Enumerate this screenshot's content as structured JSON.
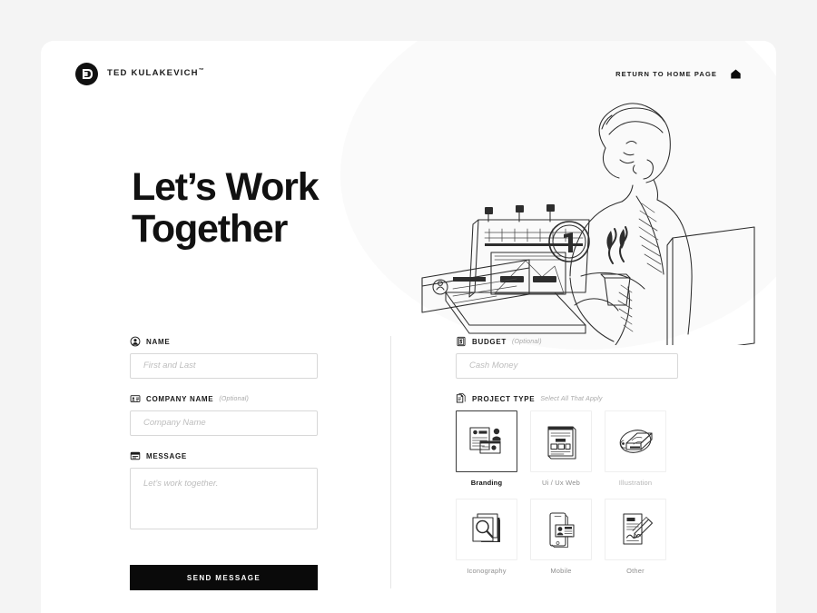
{
  "header": {
    "brand_name": "TED KULAKEVICH",
    "brand_tm": "™",
    "logo_icon": "d-monogram-icon",
    "return_label": "RETURN TO HOME PAGE",
    "home_icon": "home-icon"
  },
  "hero": {
    "title_line1": "Let’s Work",
    "title_line2": "Together",
    "illustration": "sketch-person-with-laptop-and-coffee"
  },
  "form": {
    "name": {
      "icon": "user-avatar-icon",
      "label": "NAME",
      "hint": "",
      "placeholder": "First and Last",
      "value": ""
    },
    "company": {
      "icon": "business-card-icon",
      "label": "COMPANY NAME",
      "hint": "(Optional)",
      "placeholder": "Company Name",
      "value": ""
    },
    "message": {
      "icon": "message-note-icon",
      "label": "MESSAGE",
      "hint": "",
      "placeholder": "Let’s work together.",
      "value": ""
    },
    "budget": {
      "icon": "money-bill-icon",
      "label": "BUDGET",
      "hint": "(Optional)",
      "placeholder": "Cash Money",
      "value": ""
    },
    "project_type": {
      "icon": "document-copy-icon",
      "label": "PROJECT TYPE",
      "hint": "Select All That Apply",
      "options": [
        {
          "label": "Branding",
          "icon": "branding-layout-icon",
          "selected": true
        },
        {
          "label": "Ui / Ux Web",
          "icon": "web-wireframe-icon",
          "selected": false
        },
        {
          "label": "Illustration",
          "icon": "illustration-pen-icon",
          "selected": false
        },
        {
          "label": "Iconography",
          "icon": "magnifier-stack-icon",
          "selected": false
        },
        {
          "label": "Mobile",
          "icon": "mobile-phone-icon",
          "selected": false
        },
        {
          "label": "Other",
          "icon": "signed-document-icon",
          "selected": false
        }
      ]
    },
    "submit_label": "SEND MESSAGE"
  },
  "colors": {
    "page_background": "#f4f4f4",
    "card_background": "#ffffff",
    "accent_dark": "#0a0a0a",
    "input_border": "#d8d8d8",
    "placeholder": "#bdbdbd",
    "muted_text": "#9a9a9a",
    "selected_border": "#3a3a3a"
  }
}
